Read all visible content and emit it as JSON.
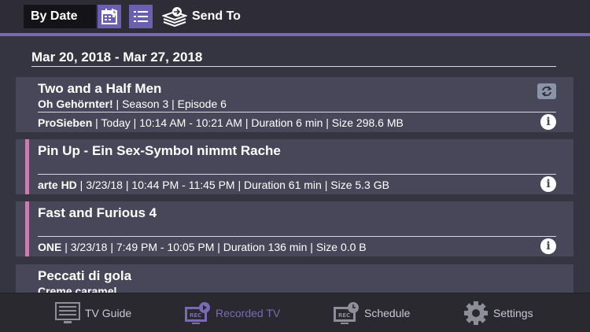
{
  "toolbar": {
    "sort_value": "By Date",
    "send_to_label": "Send To"
  },
  "content": {
    "date_range": "Mar 20, 2018 - Mar 27, 2018",
    "recordings": [
      {
        "title": "Two and a Half Men",
        "episode_title": "Oh Gehörnter!",
        "episode_info": " | Season 3 | Episode 6",
        "channel": "ProSieben",
        "details": " | Today | 10:14 AM - 10:21 AM | Duration 6 min | Size 298.6 MB"
      },
      {
        "title": "Pin Up - Ein Sex-Symbol nimmt Rache",
        "channel": "arte HD",
        "details": " | 3/23/18 | 10:44 PM - 11:45 PM | Duration 61 min | Size 5.3 GB"
      },
      {
        "title": "Fast and Furious 4",
        "channel": "ONE",
        "details": " | 3/23/18 | 7:49 PM - 10:05 PM | Duration 136 min | Size 0.0 B"
      },
      {
        "title": "Peccati di gola",
        "episode_title": "Creme caramel"
      }
    ]
  },
  "nav": {
    "tv_guide": "TV Guide",
    "recorded_tv": "Recorded TV",
    "schedule": "Schedule",
    "settings": "Settings"
  },
  "colors": {
    "accent": "#7a6ab4",
    "recording_marker": "#c87eb0",
    "card_bg": "#48475a",
    "page_bg": "#353441"
  },
  "icons": {
    "calendar": "calendar-icon",
    "list": "list-icon",
    "send_to": "send-to-icon",
    "refresh": "refresh-icon",
    "info": "info-icon",
    "tv_guide": "tv-guide-icon",
    "recorded_tv": "recorded-tv-icon",
    "schedule": "schedule-icon",
    "settings": "gear-icon"
  }
}
